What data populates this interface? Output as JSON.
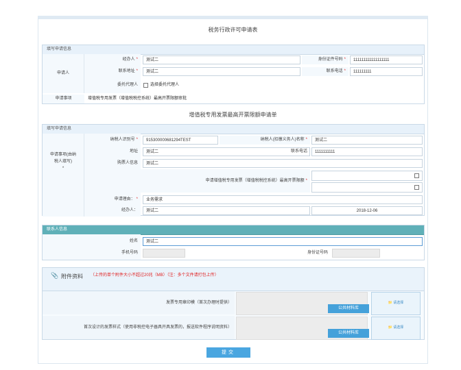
{
  "title": "税务行政许可申请表",
  "section1": {
    "head": "填写申请信息",
    "side_label": "申请人",
    "agent_label": "经办人",
    "agent_value": "测试二",
    "idno_label": "身份证件号码",
    "idno_value": "111111111111111111",
    "addr_label": "联系地址",
    "addr_value": "测试二",
    "phone_label": "联系电话",
    "phone_value": "111111111",
    "proxy_label": "委托代理人",
    "proxy_check_text": "选择委托代理人",
    "matter_label": "申请事项",
    "matter_value": "增值税专用发票（增值税税控系统）最高开票限额审批"
  },
  "subtitle": "增值税专用发票最高开票限额申请单",
  "section2": {
    "head": "填写申请信息",
    "side_label": "申请事项(由纳税人填写)",
    "side_star": "*",
    "taxid_label": "纳税人识别号",
    "taxid_value": "915300000681294TEST",
    "taxname_label": "纳税人(扣缴义务人)名称",
    "taxname_value": "测试二",
    "addr_label": "地址",
    "addr_value": "测试二",
    "phone_label": "联系电话",
    "phone_value": "1111111111",
    "buyer_label": "购票人信息",
    "buyer_value": "测试二",
    "limit_label": "申请增值税专用发票（增值税税控系统）最高开票限额",
    "reason_label": "申请理由：",
    "reason_value": "业务需求",
    "handler_label": "经办人：",
    "handler_value": "测试二",
    "date_value": "2018-12-06"
  },
  "section3": {
    "head": "联系人信息",
    "name_label": "姓名",
    "name_value": "测试二",
    "mobile_label": "手机号码",
    "idno_label": "身份证号码"
  },
  "attachments": {
    "title": "附件资料",
    "note": "（上传的单个附件大小不超过20兆（MB）（注：多个文件请打包上传）",
    "row1_label": "发票专用章印模（首次办理时提供）",
    "row2_label": "首次设计的发票样式（使用非税控电子器具开具发票的，报送软件程序说明资料）",
    "sample_btn": "公共材料库",
    "upload_btn": "请选择"
  },
  "submit_label": "提交"
}
